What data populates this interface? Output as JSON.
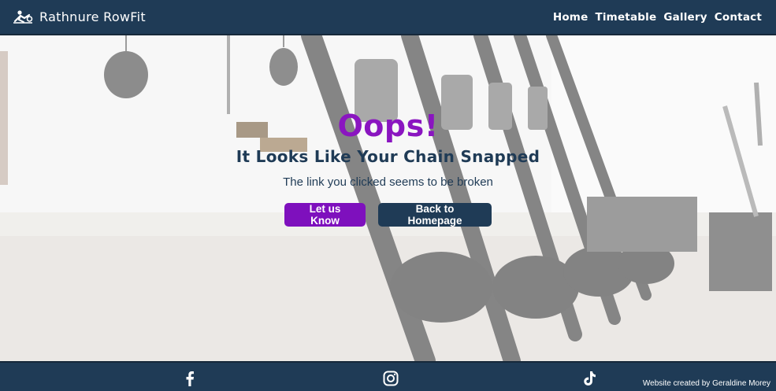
{
  "header": {
    "brand_name": "Rathnure RowFit",
    "nav": [
      {
        "label": "Home"
      },
      {
        "label": "Timetable"
      },
      {
        "label": "Gallery"
      },
      {
        "label": "Contact"
      }
    ]
  },
  "hero": {
    "title": "Oops!",
    "subtitle": "It Looks Like Your Chain Snapped",
    "message": "The link you clicked seems to be broken",
    "primary_button": "Let us Know",
    "secondary_button": "Back to Homepage"
  },
  "footer": {
    "social_icons": [
      "facebook-icon",
      "instagram-icon",
      "tiktok-icon"
    ],
    "credit": "Website created by Geraldine Morey"
  },
  "colors": {
    "navbar": "#1f3b56",
    "title_purple": "#8a15c0",
    "primary_button": "#7e10bd",
    "text_navy": "#1f3b56"
  }
}
